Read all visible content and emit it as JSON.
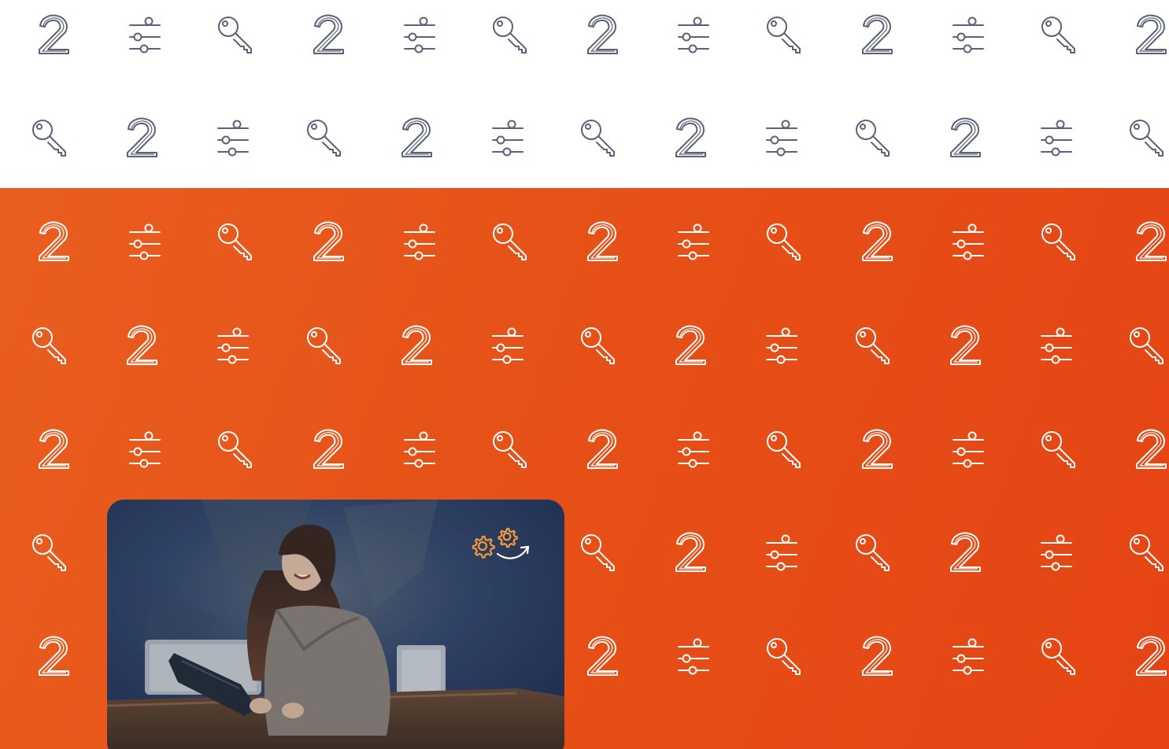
{
  "colors": {
    "background_top": "#ffffff",
    "background_bottom_gradient": [
      "#e95e1f",
      "#e65117",
      "#e54414"
    ],
    "icon_stroke_on_white": "#5b6178",
    "icon_stroke_on_orange": "#ffffff",
    "photo_accent": "#f29a38"
  },
  "pattern": {
    "icon_cycle": [
      "number-two-icon",
      "sliders-icon",
      "key-icon"
    ]
  },
  "photo": {
    "subject": "woman-with-tablet-photo",
    "badge_icon": "gears-arrow-icon"
  }
}
